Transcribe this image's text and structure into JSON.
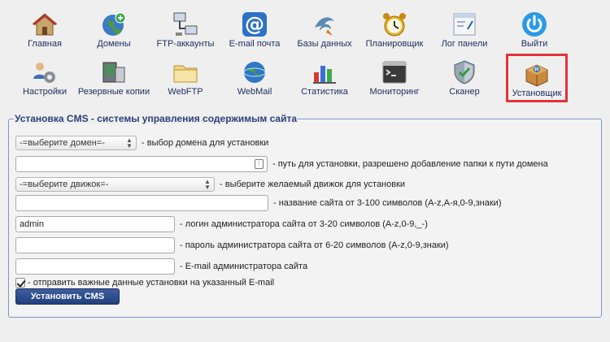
{
  "toolbar": {
    "row1": [
      {
        "label": "Главная",
        "icon": "home-icon"
      },
      {
        "label": "Домены",
        "icon": "globe-add-icon"
      },
      {
        "label": "FTP-аккаунты",
        "icon": "network-computers-icon"
      },
      {
        "label": "E-mail почта",
        "icon": "at-sign-icon"
      },
      {
        "label": "Базы данных",
        "icon": "database-dolphin-icon"
      },
      {
        "label": "Планировщик",
        "icon": "alarm-clock-icon"
      },
      {
        "label": "Лог панели",
        "icon": "log-window-icon"
      },
      {
        "label": "Выйти",
        "icon": "power-icon"
      }
    ],
    "row2": [
      {
        "label": "Настройки",
        "icon": "users-gear-icon"
      },
      {
        "label": "Резервные копии",
        "icon": "backup-icon"
      },
      {
        "label": "WebFTP",
        "icon": "folder-icon"
      },
      {
        "label": "WebMail",
        "icon": "webmail-globe-icon"
      },
      {
        "label": "Статистика",
        "icon": "bar-chart-icon"
      },
      {
        "label": "Мониторинг",
        "icon": "terminal-icon"
      },
      {
        "label": "Сканер",
        "icon": "shield-icon"
      },
      {
        "label": "Установщик",
        "icon": "package-box-icon"
      }
    ],
    "active_color": "#e3323a"
  },
  "form": {
    "legend": "Установка CMS - системы управления содержимым сайта",
    "domain_select": "-=выберите домен=-",
    "domain_desc": "- выбор домена для установки",
    "path_value": "",
    "path_desc": "- путь для установки, разрешено добавление папки к пути домена",
    "engine_select": "-=выберите движок=-",
    "engine_desc": "- выберите желаемый движок для установки",
    "site_name_value": "",
    "site_name_desc": "- название сайта от 3-100 символов (A-z,А-я,0-9,знаки)",
    "login_value": "admin",
    "login_desc": "- логин администратора сайта от 3-20 символов (A-z,0-9,_-)",
    "password_value": "",
    "password_desc": "- пароль администратора сайта от 6-20 символов (A-z,0-9,знаки)",
    "email_value": "",
    "email_desc": "- E-mail администратора сайта",
    "send_checkbox_desc": "- отправить важные данные установки на указанный E-mail",
    "submit_label": "Установить CMS"
  }
}
